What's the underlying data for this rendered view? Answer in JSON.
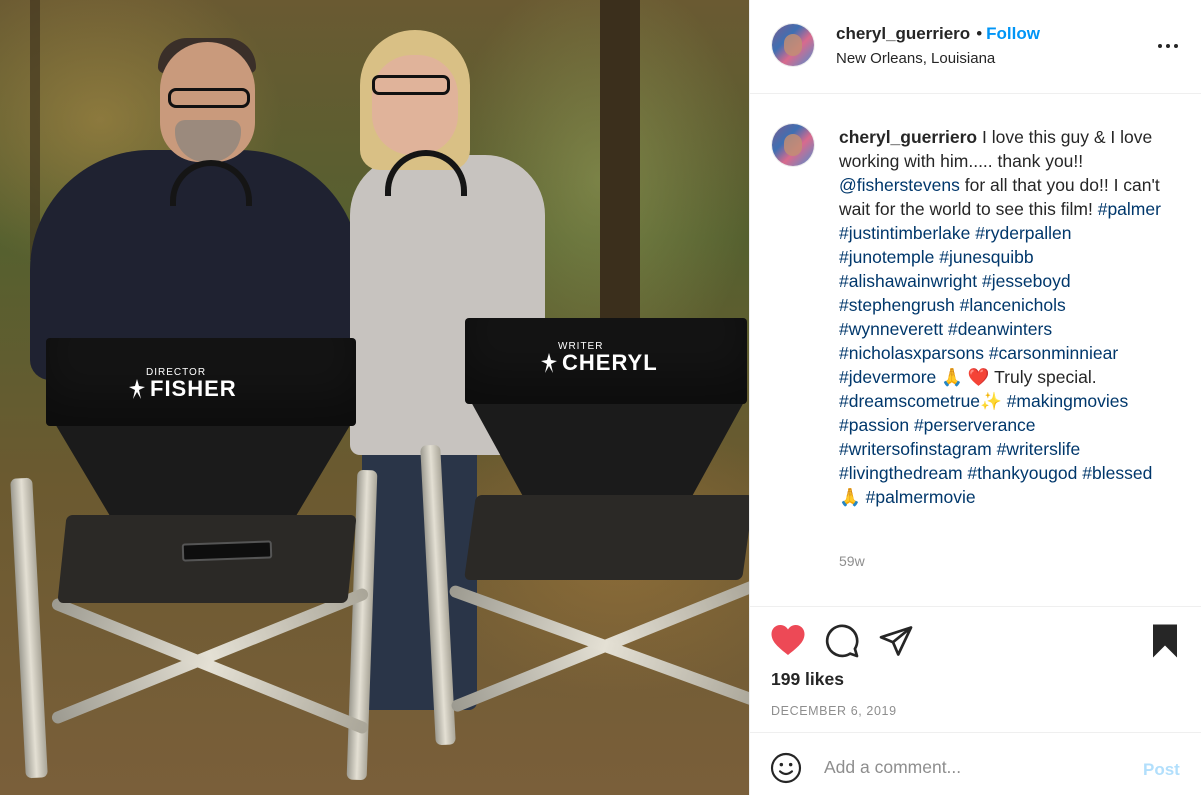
{
  "photo": {
    "chair_left": {
      "role": "DIRECTOR",
      "name": "FISHER"
    },
    "chair_right": {
      "role": "WRITER",
      "name": "CHERYL"
    }
  },
  "header": {
    "username": "cheryl_guerriero",
    "separator": "•",
    "follow_label": "Follow",
    "location": "New Orleans, Louisiana",
    "more_icon": "more-horizontal-icon"
  },
  "caption": {
    "username": "cheryl_guerriero",
    "segments": [
      {
        "t": "text",
        "v": " I love this guy & I love working with him..... thank you!! "
      },
      {
        "t": "tag",
        "v": "@fisherstevens"
      },
      {
        "t": "text",
        "v": " for all that you do!! I can't wait for the world to see this film! "
      },
      {
        "t": "tag",
        "v": "#palmer"
      },
      {
        "t": "text",
        "v": " "
      },
      {
        "t": "tag",
        "v": "#justintimberlake"
      },
      {
        "t": "text",
        "v": " "
      },
      {
        "t": "tag",
        "v": "#ryderpallen"
      },
      {
        "t": "text",
        "v": " "
      },
      {
        "t": "tag",
        "v": "#junotemple"
      },
      {
        "t": "text",
        "v": " "
      },
      {
        "t": "tag",
        "v": "#junesquibb"
      },
      {
        "t": "text",
        "v": " "
      },
      {
        "t": "tag",
        "v": "#alishawainwright"
      },
      {
        "t": "text",
        "v": " "
      },
      {
        "t": "tag",
        "v": "#jesseboyd"
      },
      {
        "t": "text",
        "v": " "
      },
      {
        "t": "tag",
        "v": "#stephengrush"
      },
      {
        "t": "text",
        "v": " "
      },
      {
        "t": "tag",
        "v": "#lancenichols"
      },
      {
        "t": "text",
        "v": " "
      },
      {
        "t": "tag",
        "v": "#wynneverett"
      },
      {
        "t": "text",
        "v": " "
      },
      {
        "t": "tag",
        "v": "#deanwinters"
      },
      {
        "t": "text",
        "v": " "
      },
      {
        "t": "tag",
        "v": "#nicholasxparsons"
      },
      {
        "t": "text",
        "v": " "
      },
      {
        "t": "tag",
        "v": "#carsonminniear"
      },
      {
        "t": "text",
        "v": " "
      },
      {
        "t": "tag",
        "v": "#jdevermore"
      },
      {
        "t": "text",
        "v": " 🙏 ❤️ Truly special. "
      },
      {
        "t": "tag",
        "v": "#dreamscometrue"
      },
      {
        "t": "text",
        "v": "✨ "
      },
      {
        "t": "tag",
        "v": "#makingmovies"
      },
      {
        "t": "text",
        "v": " "
      },
      {
        "t": "tag",
        "v": "#passion"
      },
      {
        "t": "text",
        "v": " "
      },
      {
        "t": "tag",
        "v": "#perserverance"
      },
      {
        "t": "text",
        "v": " "
      },
      {
        "t": "tag",
        "v": "#writersofinstagram"
      },
      {
        "t": "text",
        "v": " "
      },
      {
        "t": "tag",
        "v": "#writerslife"
      },
      {
        "t": "text",
        "v": " "
      },
      {
        "t": "tag",
        "v": "#livingthedream"
      },
      {
        "t": "text",
        "v": " "
      },
      {
        "t": "tag",
        "v": "#thankyougod"
      },
      {
        "t": "text",
        "v": " "
      },
      {
        "t": "tag",
        "v": "#blessed"
      },
      {
        "t": "text",
        "v": "🙏 "
      },
      {
        "t": "tag",
        "v": "#palmermovie"
      }
    ],
    "time_ago": "59w"
  },
  "actions": {
    "liked": true,
    "saved": true,
    "like_color": "#ed4956",
    "likes_text": "199 likes",
    "date": "DECEMBER 6, 2019"
  },
  "comment": {
    "placeholder": "Add a comment...",
    "post_label": "Post",
    "post_color": "#b2dffc"
  },
  "colors": {
    "link": "#00376b",
    "follow": "#0095f6",
    "muted": "#8e8e8e"
  }
}
